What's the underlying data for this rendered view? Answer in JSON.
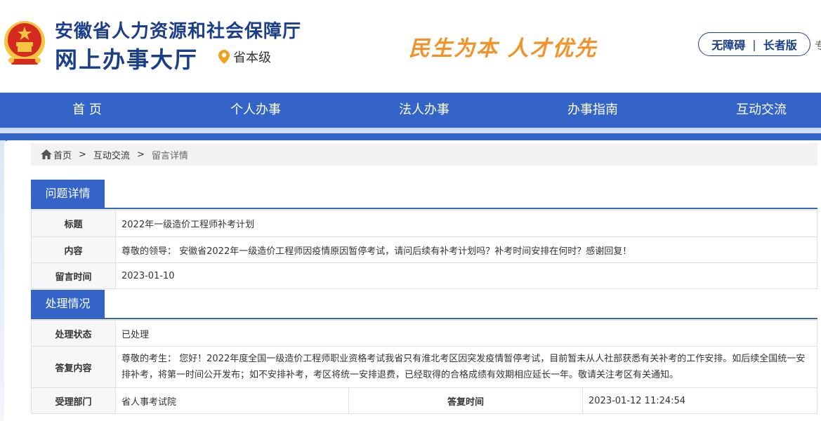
{
  "header": {
    "title": "安徽省人力资源和社会保障厅",
    "subtitle": "网上办事大厅",
    "location": "省本级",
    "slogan": "民生为本  人才优先",
    "accessibility": "无障碍",
    "elder": "长者版",
    "separator": "|",
    "edge_glyph": "专"
  },
  "nav": {
    "items": [
      {
        "label": "首 页"
      },
      {
        "label": "个人办事"
      },
      {
        "label": "法人办事"
      },
      {
        "label": "办事指南"
      },
      {
        "label": "互动交流"
      }
    ]
  },
  "breadcrumb": {
    "home": "首页",
    "sep": ">",
    "level1": "互动交流",
    "current": "留言详情"
  },
  "question": {
    "section_title": "问题详情",
    "title_label": "标题",
    "title_value": "2022年一级造价工程师补考计划",
    "content_label": "内容",
    "content_value": "尊敬的领导： 安徽省2022年一级造价工程师因疫情原因暂停考试，请问后续有补考计划吗？补考时间安排在何时？感谢回复！",
    "time_label": "留言时间",
    "time_value": "2023-01-10"
  },
  "handling": {
    "section_title": "处理情况",
    "status_label": "处理状态",
    "status_value": "已处理",
    "reply_label": "答复内容",
    "reply_value": "尊敬的考生： 您好！2022年度全国一级造价工程师职业资格考试我省只有淮北考区因突发疫情暂停考试，目前暂未从人社部获悉有关补考的工作安排。如后续全国统一安排补考，将第一时间公开发布；如不安排补考，考区将统一安排退费，已经取得的合格成绩有效期相应延长一年。敬请关注考区有关通知。",
    "dept_label": "受理部门",
    "dept_value": "省人事考试院",
    "reply_time_label": "答复时间",
    "reply_time_value": "2023-01-12 11:24:54"
  },
  "colors": {
    "primary": "#3464c8",
    "title": "#1a3e8a",
    "slogan": "#f0932b",
    "emblem_red": "#d42a1f",
    "emblem_gold": "#f5c542"
  }
}
